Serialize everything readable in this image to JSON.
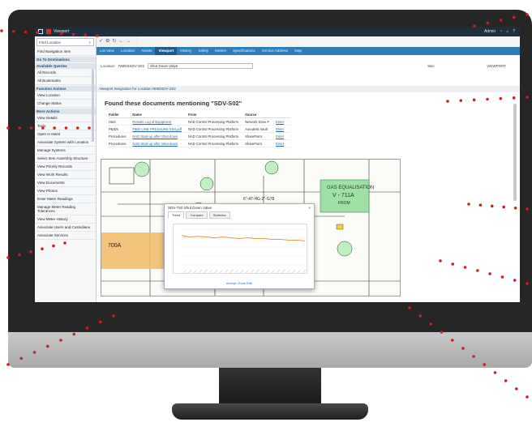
{
  "sidebar": {
    "search_value": "Find Location",
    "nav_title": "Find Navigation Item",
    "section1": "Go To Destinations",
    "section2": "Available Queries",
    "items_a": [
      "All Records",
      "All Bookmarks"
    ],
    "section3": "Function Actions",
    "items_b": [
      "View Location",
      "Change Status"
    ],
    "section4": "More Actions",
    "items_c": [
      "View Details",
      "Tools",
      "Open In Maint",
      "Associate System with Location",
      "Manage Systems",
      "Select Item Assembly Structure",
      "View Priority Records",
      "View Work Results",
      "View Documents",
      "View Photos",
      "Enter Meter Readings",
      "Manage Meter Reading Tolerances",
      "View Meter History",
      "Associate Users and Custodians",
      "Associate Services"
    ]
  },
  "tabs": [
    "List View",
    "Location",
    "Assets",
    "Viewport",
    "History",
    "Safety",
    "Meters",
    "Specifications",
    "Service Address",
    "Map"
  ],
  "active_tab": "Viewport",
  "location": {
    "label": "Location:",
    "code": "NMDSSDV-S02",
    "desc": "Shut Down Valve"
  },
  "site": {
    "label": "Site:",
    "value": "VIEWPORT"
  },
  "integration_title": "Viewport Integration for Location NMDSDV-S02",
  "found_title": "Found these documents mentioning \"SDV-S02\"",
  "doc_headers": [
    "Folder",
    "Name",
    "From",
    "Source",
    ""
  ],
  "docs": [
    [
      "H&S",
      "Results Log of Equipment",
      "NAD Control Processing Platform",
      "Network Drive F",
      "Enter"
    ],
    [
      "P&IDs",
      "P&ID LINE PRESSURE Inlet.pdf",
      "NAD Control Processing Platform",
      "Autodesk Vault",
      "Enter"
    ],
    [
      "Procedures",
      "NAD Start-up after Shut-down",
      "NAD Control Processing Platform",
      "SharePoint",
      "Enter"
    ],
    [
      "Procedures",
      "NAD Start-up after Shut-down",
      "NAD Control Processing Platform",
      "SharePoint",
      "Enter"
    ]
  ],
  "drawing": {
    "tag1": "GAS EQUALISATION",
    "tag2": "V - 711A",
    "tag3": "FROM",
    "line": "6\"-47-HG-2\"-G78",
    "orange1": "700A"
  },
  "popup": {
    "title": "SDV-7S0 Shut Down Valve",
    "tabs": [
      "Trend",
      "Compare",
      "Statistics"
    ],
    "footer": "Accept: Done Edit"
  },
  "chart_data": {
    "type": "line",
    "series": [
      {
        "values": [
          42,
          40,
          41,
          40,
          39,
          40,
          39,
          38,
          39,
          38,
          38,
          37,
          37,
          36,
          36,
          35
        ]
      }
    ]
  },
  "colors": {
    "accent": "#2d7eb8",
    "bezel": "#262626",
    "dots": "#cc1f1f",
    "highlight_orange": "#f2b866",
    "highlight_green": "#9fe0a6"
  }
}
